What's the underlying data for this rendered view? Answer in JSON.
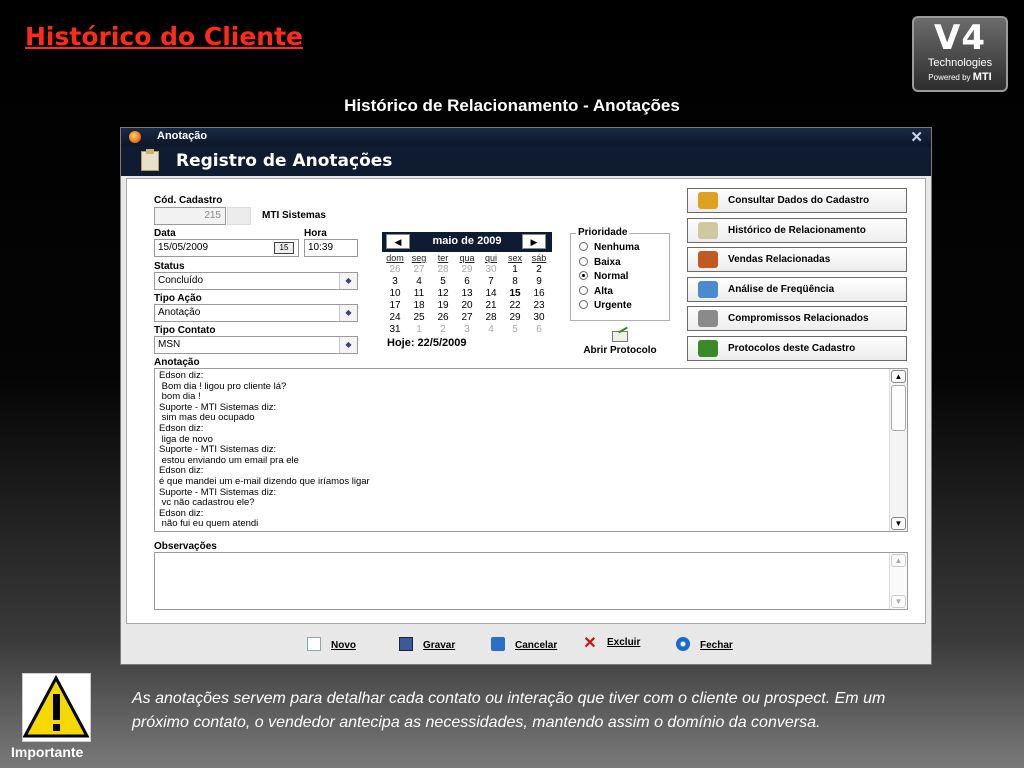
{
  "slide": {
    "title": "Histórico do Cliente",
    "subtitle": "Histórico de Relacionamento - Anotações",
    "logo": {
      "big": "V4",
      "tech": "Technologies",
      "powered": "Powered by",
      "brand": "MTI"
    },
    "warning_label": "Importante",
    "description": "As anotações servem para detalhar cada contato ou interação que tiver com o cliente ou prospect. Em um próximo contato, o vendedor antecipa as necessidades, mantendo assim o domínio da conversa."
  },
  "window": {
    "title": "Anotação",
    "header": "Registro de Anotações",
    "close": "✕"
  },
  "form": {
    "cod_label": "Cód. Cadastro",
    "cod_value": "215",
    "company": "MTI Sistemas",
    "data_label": "Data",
    "data_value": "15/05/2009",
    "hora_label": "Hora",
    "hora_value": "10:39",
    "status_label": "Status",
    "status_value": "Concluído",
    "tipo_acao_label": "Tipo Ação",
    "tipo_acao_value": "Anotação",
    "tipo_contato_label": "Tipo Contato",
    "tipo_contato_value": "MSN",
    "anotacao_label": "Anotação",
    "observacoes_label": "Observações"
  },
  "calendar": {
    "month": "maio de 2009",
    "prev": "◀",
    "next": "▶",
    "weekdays": [
      "dom",
      "seg",
      "ter",
      "qua",
      "qui",
      "sex",
      "sáb"
    ],
    "weeks": [
      [
        "26",
        "27",
        "28",
        "29",
        "30",
        "1",
        "2"
      ],
      [
        "3",
        "4",
        "5",
        "6",
        "7",
        "8",
        "9"
      ],
      [
        "10",
        "11",
        "12",
        "13",
        "14",
        "15",
        "16"
      ],
      [
        "17",
        "18",
        "19",
        "20",
        "21",
        "22",
        "23"
      ],
      [
        "24",
        "25",
        "26",
        "27",
        "28",
        "29",
        "30"
      ],
      [
        "31",
        "1",
        "2",
        "3",
        "4",
        "5",
        "6"
      ]
    ],
    "today": "Hoje: 22/5/2009"
  },
  "priority": {
    "legend": "Prioridade",
    "options": [
      "Nenhuma",
      "Baixa",
      "Normal",
      "Alta",
      "Urgente"
    ],
    "selected": "Normal"
  },
  "protocol_label": "Abrir Protocolo",
  "side_buttons": [
    "Consultar Dados do Cadastro",
    "Histórico de Relacionamento",
    "Vendas Relacionadas",
    "Análise de Freqüência",
    "Compromissos Relacionados",
    "Protocolos deste Cadastro"
  ],
  "notes_lines": [
    "Edson diz:",
    " Bom dia ! ligou pro cliente lá?",
    " bom dia !",
    "Suporte - MTI Sistemas diz:",
    " sim mas deu ocupado",
    "Edson diz:",
    " liga de novo",
    "Suporte - MTI Sistemas diz:",
    " estou enviando um email pra ele",
    "Edson diz:",
    "é que mandei um e-mail dizendo que iríamos ligar",
    "Suporte - MTI Sistemas diz:",
    " vc não cadastrou ele?",
    "Edson diz:",
    " não fui eu quem atendi"
  ],
  "footer_buttons": [
    "Novo",
    "Gravar",
    "Cancelar",
    "Excluir",
    "Fechar"
  ],
  "colors": {
    "title_red": "#ff2a1a",
    "window_dark": "#0e1b30"
  }
}
